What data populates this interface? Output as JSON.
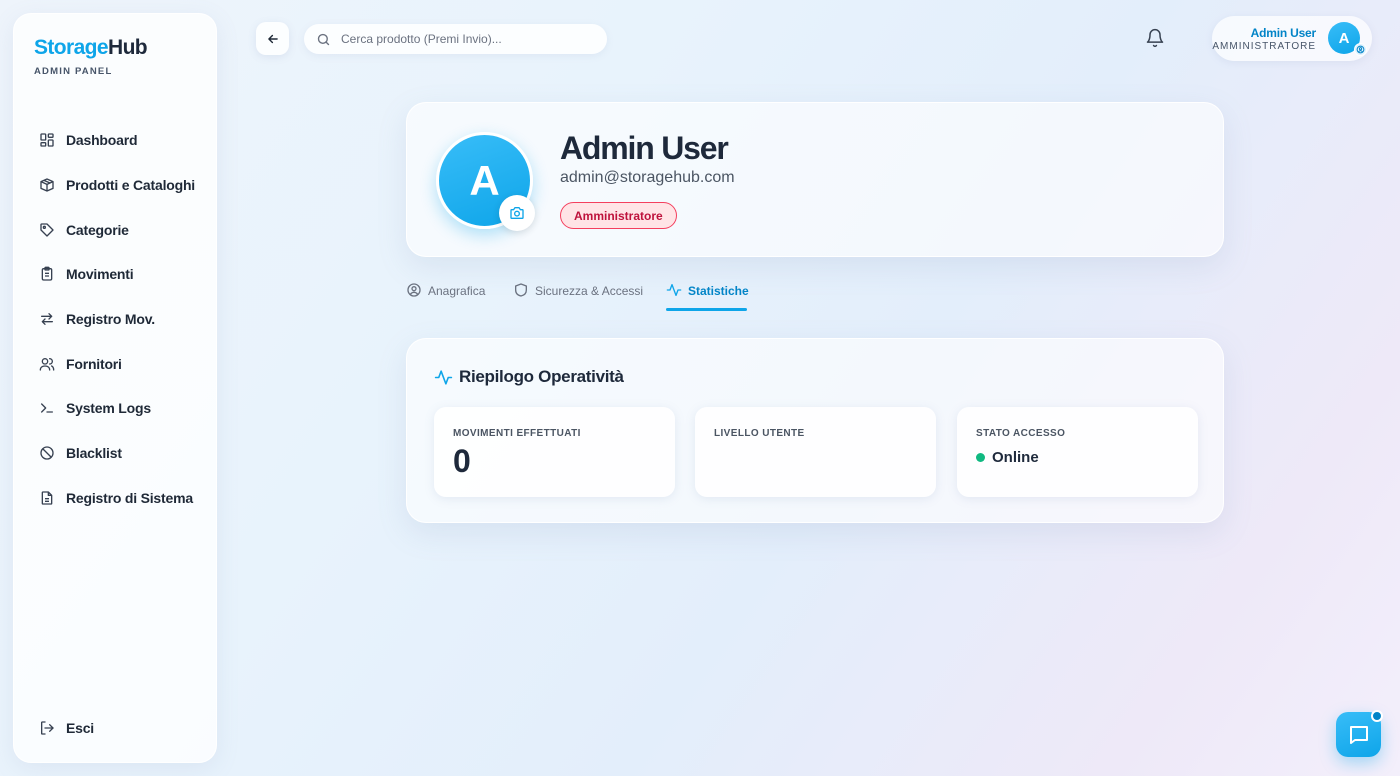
{
  "brand": {
    "part1": "Storage",
    "part2": "Hub",
    "subtitle": "ADMIN PANEL"
  },
  "sidebar": {
    "items": [
      {
        "label": "Dashboard",
        "icon": "dashboard-icon"
      },
      {
        "label": "Prodotti e Cataloghi",
        "icon": "box-icon"
      },
      {
        "label": "Categorie",
        "icon": "tag-icon"
      },
      {
        "label": "Movimenti",
        "icon": "clipboard-icon"
      },
      {
        "label": "Registro Mov.",
        "icon": "arrows-exchange-icon"
      },
      {
        "label": "Fornitori",
        "icon": "users-icon"
      },
      {
        "label": "System Logs",
        "icon": "terminal-icon"
      },
      {
        "label": "Blacklist",
        "icon": "ban-icon"
      },
      {
        "label": "Registro di Sistema",
        "icon": "file-text-icon"
      }
    ],
    "logout_label": "Esci"
  },
  "header": {
    "search_placeholder": "Cerca prodotto (Premi Invio)...",
    "user_name": "Admin User",
    "user_role": "AMMINISTRATORE",
    "avatar_letter": "A"
  },
  "profile": {
    "avatar_letter": "A",
    "name": "Admin User",
    "email": "admin@storagehub.com",
    "role_badge": "Amministratore"
  },
  "tabs": [
    {
      "label": "Anagrafica",
      "icon": "user-circle-icon",
      "active": false
    },
    {
      "label": "Sicurezza & Accessi",
      "icon": "shield-icon",
      "active": false
    },
    {
      "label": "Statistiche",
      "icon": "activity-icon",
      "active": true
    }
  ],
  "stats": {
    "title": "Riepilogo Operatività",
    "cards": [
      {
        "label": "MOVIMENTI EFFETTUATI",
        "value": "0"
      },
      {
        "label": "LIVELLO UTENTE",
        "value": ""
      },
      {
        "label": "STATO ACCESSO",
        "value": "Online"
      }
    ]
  },
  "colors": {
    "accent": "#0ea5e9",
    "accent_dark": "#0284c7",
    "badge_bg": "#ffe4e6",
    "badge_text": "#be123c",
    "online": "#10b981"
  }
}
